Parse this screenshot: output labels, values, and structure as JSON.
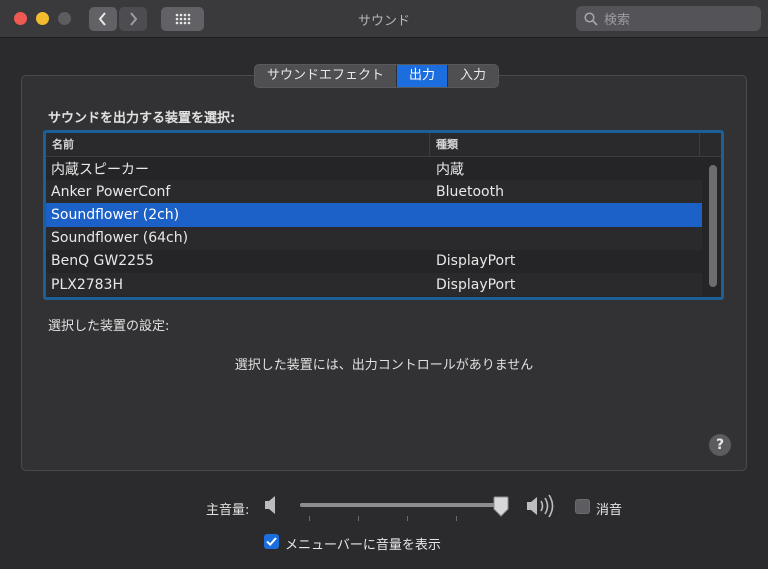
{
  "window": {
    "title": "サウンド"
  },
  "search": {
    "placeholder": "検索"
  },
  "tabs": [
    {
      "label": "サウンドエフェクト",
      "active": false
    },
    {
      "label": "出力",
      "active": true
    },
    {
      "label": "入力",
      "active": false
    }
  ],
  "output": {
    "heading": "サウンドを出力する装置を選択:",
    "columns": {
      "name": "名前",
      "type": "種類"
    },
    "devices": [
      {
        "name": "内蔵スピーカー",
        "type": "内蔵",
        "selected": false
      },
      {
        "name": "Anker PowerConf",
        "type": "Bluetooth",
        "selected": false
      },
      {
        "name": "Soundflower (2ch)",
        "type": "",
        "selected": true
      },
      {
        "name": "Soundflower (64ch)",
        "type": "",
        "selected": false
      },
      {
        "name": "BenQ GW2255",
        "type": "DisplayPort",
        "selected": false
      },
      {
        "name": "PLX2783H",
        "type": "DisplayPort",
        "selected": false
      }
    ],
    "settings_label": "選択した装置の設定:",
    "no_controls_message": "選択した装置には、出力コントロールがありません",
    "help_label": "?"
  },
  "volume": {
    "label": "主音量:",
    "level": 1.0,
    "mute_label": "消音",
    "muted": false,
    "show_in_menubar_label": "メニューバーに音量を表示",
    "show_in_menubar": true
  },
  "colors": {
    "accent": "#1c6ede",
    "selection": "#1c61c8",
    "focus_ring": "#1d5f97"
  }
}
